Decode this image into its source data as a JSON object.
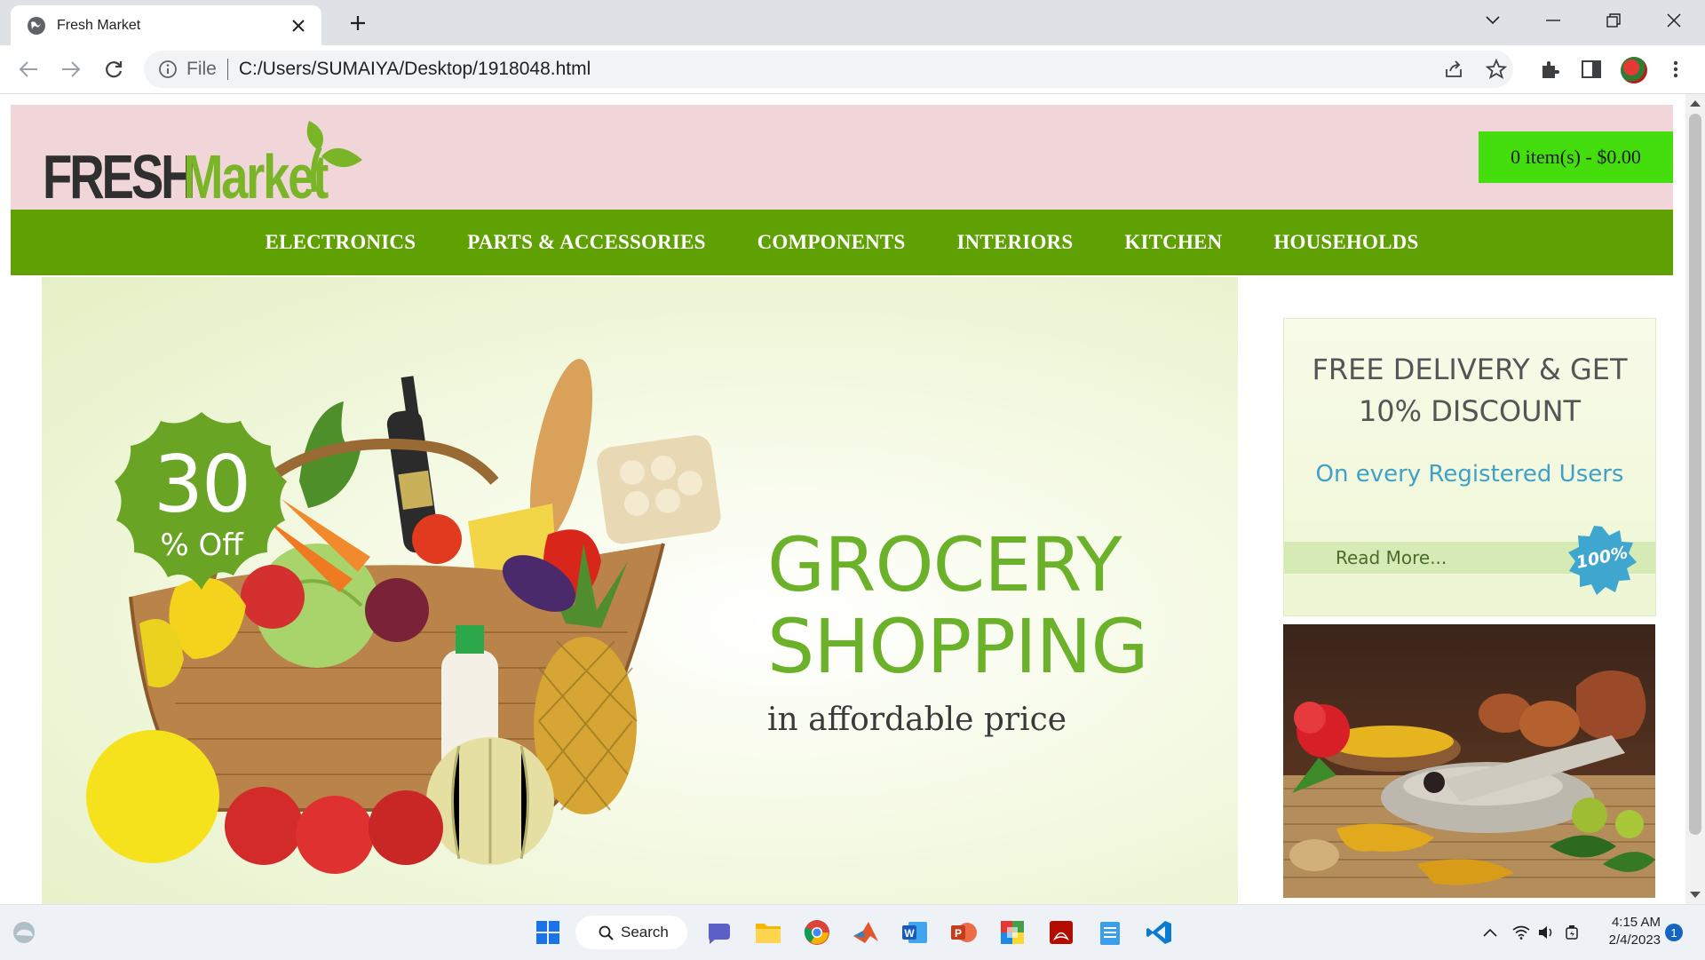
{
  "browser": {
    "tab_title": "Fresh Market",
    "scheme_label": "File",
    "url": "C:/Users/SUMAIYA/Desktop/1918048.html"
  },
  "site": {
    "logo": {
      "word1": "FRESH",
      "word2": "Market"
    },
    "cart_label": "0 item(s) - $0.00",
    "nav": [
      "ELECTRONICS",
      "PARTS & ACCESSORIES",
      "COMPONENTS",
      "INTERIORS",
      "KITCHEN",
      "HOUSEHOLDS"
    ],
    "hero": {
      "badge_number": "30",
      "badge_label": "% Off",
      "heading_line1": "GROCERY",
      "heading_line2": "SHOPPING",
      "tagline": "in affordable price"
    },
    "promo": {
      "title_line1": "FREE DELIVERY & GET",
      "title_line2": "10% DISCOUNT",
      "subtitle": "On every Registered Users",
      "read_more": "Read More...",
      "seal": "100%"
    }
  },
  "taskbar": {
    "search_label": "Search",
    "time": "4:15 AM",
    "date": "2/4/2023",
    "notification_count": "1"
  },
  "colors": {
    "header_bg": "#f0d6d9",
    "nav_bg": "#5fa003",
    "cart_bg": "#44dd0e",
    "brand_green": "#7ab527",
    "promo_link": "#3fa1c8"
  }
}
